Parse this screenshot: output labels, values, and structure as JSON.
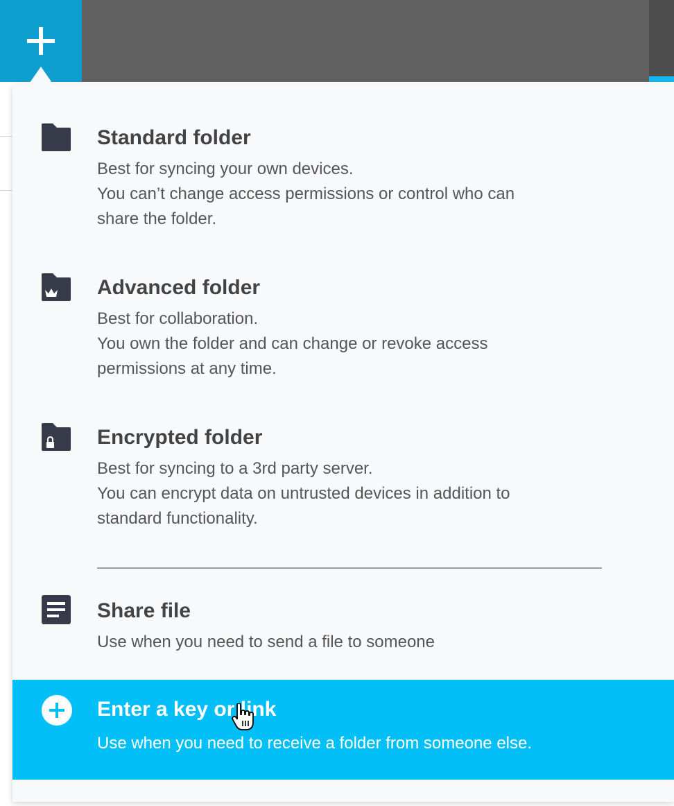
{
  "header": {
    "add_icon": "plus-icon",
    "colors": {
      "bar": "#606060",
      "add_button": "#0f9fcf",
      "accent": "#12b7ef"
    }
  },
  "menu": {
    "items": [
      {
        "title": "Standard folder",
        "icon": "folder-icon",
        "lines": [
          "Best for syncing your own devices.",
          "You can’t change access permissions or control who can",
          "share the folder."
        ]
      },
      {
        "title": "Advanced folder",
        "icon": "folder-crown-icon",
        "lines": [
          "Best for collaboration.",
          "You own the folder and can change or revoke access",
          "permissions at any time."
        ]
      },
      {
        "title": "Encrypted folder",
        "icon": "folder-lock-icon",
        "lines": [
          "Best for syncing to a 3rd party server.",
          "You can encrypt data on untrusted devices in addition to",
          "standard functionality."
        ]
      },
      {
        "title": "Share file",
        "icon": "file-icon",
        "lines": [
          "Use when you need to send a file to someone"
        ]
      },
      {
        "title": "Enter a key or link",
        "icon": "plus-circle-icon",
        "lines": [
          "Use when you need to receive a folder from someone else."
        ],
        "highlighted": true
      }
    ],
    "colors": {
      "background": "#f8f9fb",
      "highlight": "#03bff7",
      "icon": "#363a49"
    }
  }
}
